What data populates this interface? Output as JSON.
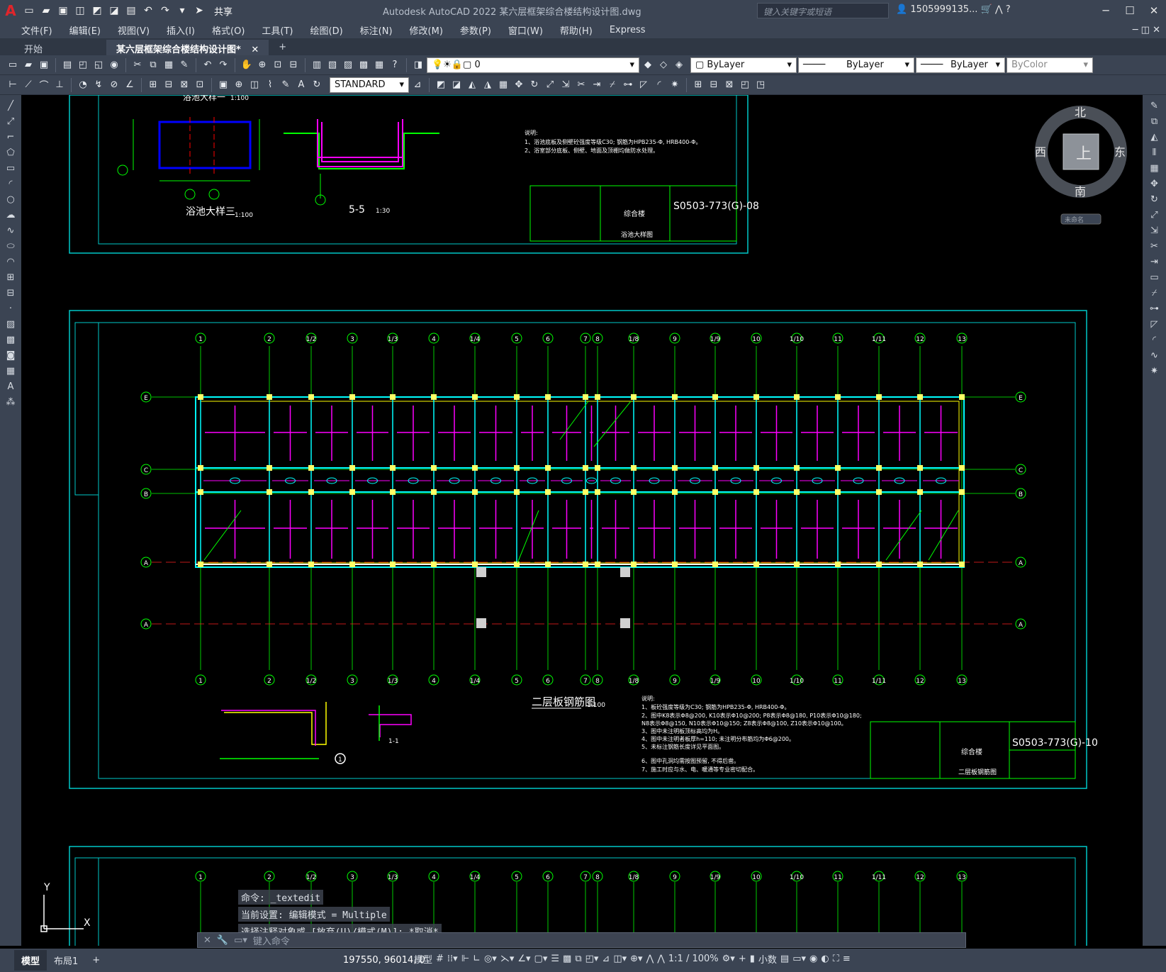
{
  "app": {
    "logo": "A",
    "title": "Autodesk AutoCAD 2022    某六层框架综合楼结构设计图.dwg",
    "search_placeholder": "键入关键字或短语",
    "user": "1505999135...",
    "share_label": "共享"
  },
  "menu": [
    "文件(F)",
    "编辑(E)",
    "视图(V)",
    "插入(I)",
    "格式(O)",
    "工具(T)",
    "绘图(D)",
    "标注(N)",
    "修改(M)",
    "参数(P)",
    "窗口(W)",
    "帮助(H)",
    "Express"
  ],
  "tabs": {
    "start": "开始",
    "active": "某六层框架综合楼结构设计图*",
    "add": "+"
  },
  "properties": {
    "layer": "0",
    "color": "ByLayer",
    "linetype": "ByLayer",
    "lineweight": "ByLayer",
    "plotstyle": "ByColor",
    "text_style": "STANDARD"
  },
  "viewcube": {
    "north": "北",
    "south": "南",
    "east": "东",
    "west": "西",
    "top": "上",
    "ucs": "未命名"
  },
  "drawing": {
    "upper_label_1": "浴池大样一",
    "upper_label_3": "浴池大样三",
    "upper_scale": "1:100",
    "section_label": "5-5",
    "section_scale": "1:30",
    "upper_notes_title": "说明:",
    "upper_notes_1": "1、浴池底板及侧壁砼强度等级C30; 钢筋为HPB235-Φ, HRB400-Φ。",
    "upper_notes_2": "2、浴室部分底板、侧壁、地面及顶棚均做防水处理。",
    "upper_drawing_no": "S0503-773(G)-08",
    "upper_project": "综合楼",
    "upper_sheet": "浴池大样图",
    "main_title": "二层板钢筋图",
    "main_scale": "1:100",
    "main_drawing_no": "S0503-773(G)-10",
    "main_project": "综合楼",
    "main_sheet": "二层板钢筋图",
    "notes_title": "说明:",
    "notes": [
      "1、板砼强度等级为C30; 钢筋为HPB235-Φ, HRB400-Φ。",
      "2、图中K8表示Φ8@200, K10表示Φ10@200; P8表示Φ8@180, P10表示Φ10@180;",
      "   N8表示Φ8@150, N10表示Φ10@150; Z8表示Φ8@100, Z10表示Φ10@100。",
      "3、图中未注明板顶标高均为H。",
      "4、图中未注明者板厚h=110; 未注明分布筋均为Φ6@200。",
      "5、未标注钢筋长度详见平面图。",
      "6、图中孔洞均需按图预留, 不得后凿。",
      "7、施工时应与水、电、暖通等专业密切配合。"
    ],
    "axes_top": [
      "1",
      "2",
      "1/2",
      "3",
      "1/3",
      "4",
      "1/4",
      "5",
      "6",
      "7",
      "8",
      "1/8",
      "9",
      "1/9",
      "10",
      "1/10",
      "11",
      "1/11",
      "12",
      "13"
    ],
    "axes_side": [
      "E",
      "C",
      "B",
      "A",
      "A"
    ],
    "section_mark": "1-1",
    "circle_mark": "1"
  },
  "command": {
    "history": [
      "命令: _textedit",
      "当前设置: 编辑模式 = Multiple",
      "选择注释对象或 [放弃(U)/模式(M)]: *取消*"
    ],
    "prompt": "键入命令"
  },
  "status": {
    "model_tab": "模型",
    "layout_tab": "布局1",
    "add": "+",
    "coordinates": "197550, 96014, 0",
    "space": "模型",
    "scale": "1:1 / 100%",
    "units": "小数"
  },
  "colors": {
    "grid_axis": "#00ff00",
    "rebar": "#ff00ff",
    "beam": "#00ffff",
    "border": "#00c8c8",
    "column": "#ffff00",
    "dim": "#ff2020"
  }
}
